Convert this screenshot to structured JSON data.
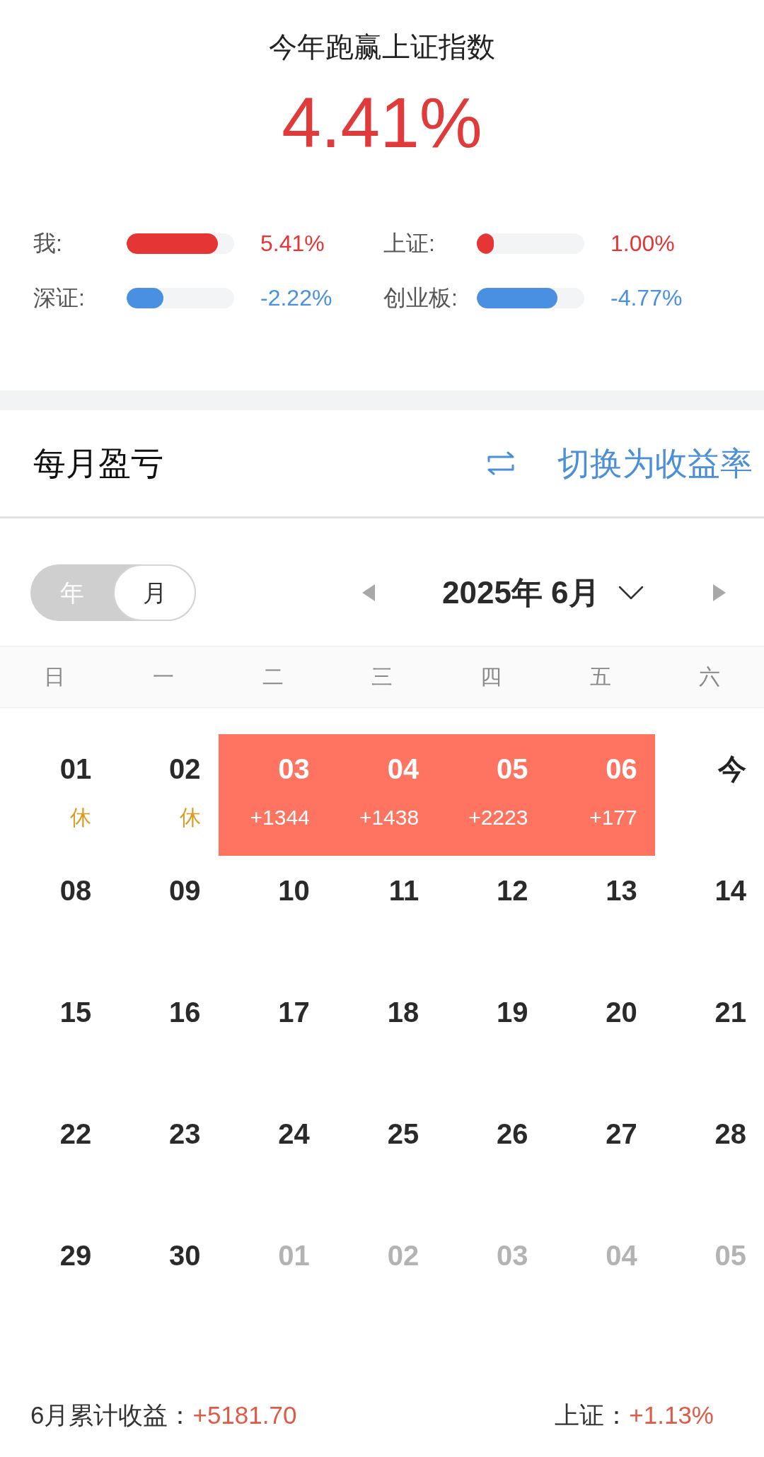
{
  "summary": {
    "title": "今年跑赢上证指数",
    "value": "4.41%"
  },
  "comparisons": [
    {
      "label": "我:",
      "level": 0.85,
      "reading": "5.41%",
      "color": "#e53535"
    },
    {
      "label": "上证:",
      "level": 0.16,
      "reading": "1.00%",
      "color": "#e53535"
    },
    {
      "label": "深证:",
      "level": 0.34,
      "reading": "-2.22%",
      "color": "#4a90e2"
    },
    {
      "label": "创业板:",
      "level": 0.75,
      "reading": "-4.77%",
      "color": "#4a90e2"
    }
  ],
  "section": {
    "title": "每月盈亏",
    "switch_label": "切换为收益率"
  },
  "view_toggle": [
    {
      "label": "年",
      "selected": false
    },
    {
      "label": "月",
      "selected": true
    }
  ],
  "month_nav": {
    "label": "2025年 6月"
  },
  "weekdays": [
    "日",
    "一",
    "二",
    "三",
    "四",
    "五",
    "六"
  ],
  "weeks": [
    [
      {
        "day": "01",
        "note": "休",
        "kind": "holiday"
      },
      {
        "day": "02",
        "note": "休",
        "kind": "holiday"
      },
      {
        "day": "03",
        "note": "+1344",
        "kind": "profit"
      },
      {
        "day": "04",
        "note": "+1438",
        "kind": "profit"
      },
      {
        "day": "05",
        "note": "+2223",
        "kind": "profit"
      },
      {
        "day": "06",
        "note": "+177",
        "kind": "profit"
      },
      {
        "day": "今",
        "kind": "today"
      }
    ],
    [
      {
        "day": "08",
        "kind": "normal"
      },
      {
        "day": "09",
        "kind": "normal"
      },
      {
        "day": "10",
        "kind": "normal"
      },
      {
        "day": "11",
        "kind": "normal"
      },
      {
        "day": "12",
        "kind": "normal"
      },
      {
        "day": "13",
        "kind": "normal"
      },
      {
        "day": "14",
        "kind": "normal"
      }
    ],
    [
      {
        "day": "15",
        "kind": "normal"
      },
      {
        "day": "16",
        "kind": "normal"
      },
      {
        "day": "17",
        "kind": "normal"
      },
      {
        "day": "18",
        "kind": "normal"
      },
      {
        "day": "19",
        "kind": "normal"
      },
      {
        "day": "20",
        "kind": "normal"
      },
      {
        "day": "21",
        "kind": "normal"
      }
    ],
    [
      {
        "day": "22",
        "kind": "normal"
      },
      {
        "day": "23",
        "kind": "normal"
      },
      {
        "day": "24",
        "kind": "normal"
      },
      {
        "day": "25",
        "kind": "normal"
      },
      {
        "day": "26",
        "kind": "normal"
      },
      {
        "day": "27",
        "kind": "normal"
      },
      {
        "day": "28",
        "kind": "normal"
      }
    ],
    [
      {
        "day": "29",
        "kind": "normal"
      },
      {
        "day": "30",
        "kind": "normal"
      },
      {
        "day": "01",
        "kind": "other_month"
      },
      {
        "day": "02",
        "kind": "other_month"
      },
      {
        "day": "03",
        "kind": "other_month"
      },
      {
        "day": "04",
        "kind": "other_month"
      },
      {
        "day": "05",
        "kind": "other_month"
      }
    ]
  ],
  "footer": [
    {
      "label": "6月累计收益：",
      "value": "+5181.70"
    },
    {
      "label": "上证：",
      "value": "+1.13%"
    }
  ]
}
